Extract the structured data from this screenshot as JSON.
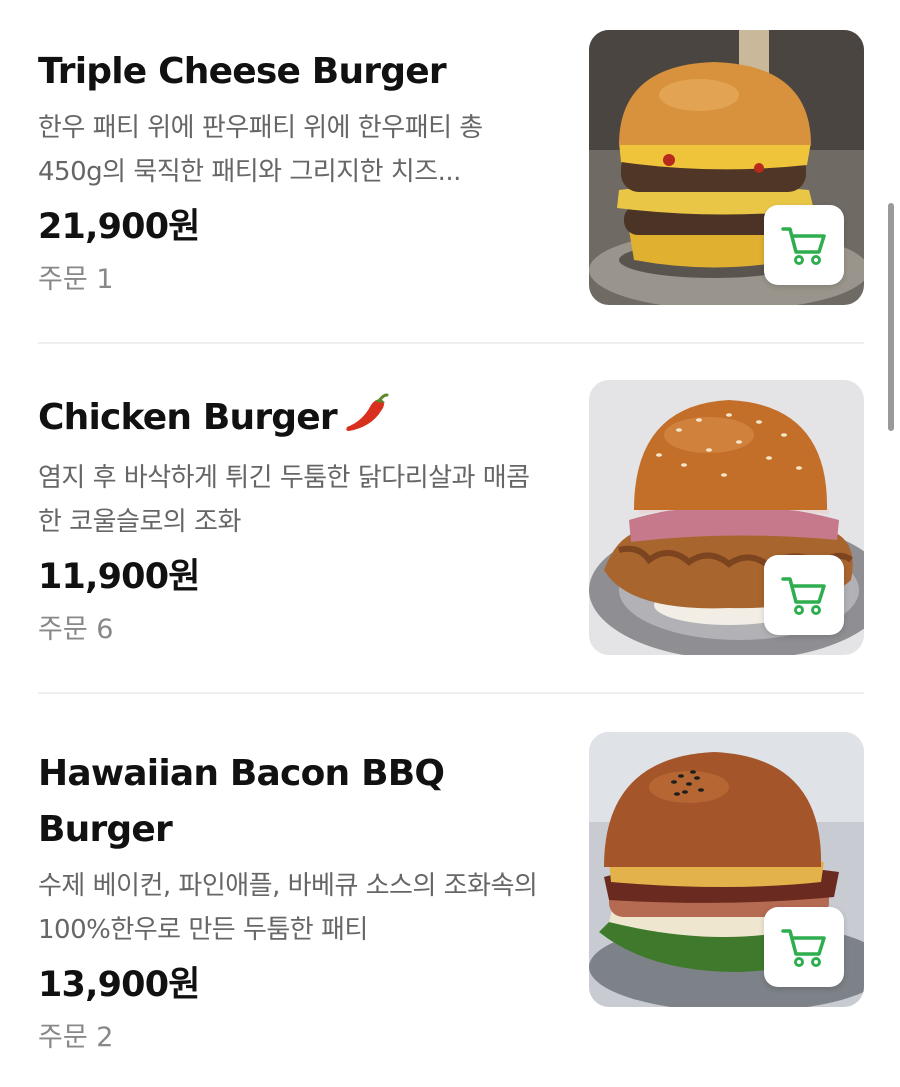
{
  "menu": {
    "items": [
      {
        "title": "Triple Cheese Burger",
        "description": "한우 패티 위에 판우패티 위에 한우패티 총 450g의 묵직한 패티와 그리지한 치즈...",
        "price": "21,900원",
        "orders": "주문 1",
        "spicy": false,
        "image_icon": "burger-photo",
        "cart_icon": "cart-icon"
      },
      {
        "title": "Chicken Burger",
        "description": "염지 후 바삭하게 튀긴 두툼한 닭다리살과 매콤한 코울슬로의 조화",
        "price": "11,900원",
        "orders": "주문 6",
        "spicy": true,
        "badge_icon": "chili-pepper-icon",
        "image_icon": "burger-photo",
        "cart_icon": "cart-icon"
      },
      {
        "title": "Hawaiian Bacon BBQ Burger",
        "description": "수제 베이컨, 파인애플, 바베큐 소스의 조화속의 100%한우로 만든 두툼한 패티",
        "price": "13,900원",
        "orders": "주문 2",
        "spicy": false,
        "image_icon": "burger-photo",
        "cart_icon": "cart-icon"
      }
    ]
  },
  "colors": {
    "cart_icon": "#2eae4f",
    "chili": "#d9301e",
    "divider": "#eeeeee",
    "description": "#666666",
    "orders": "#888888"
  }
}
